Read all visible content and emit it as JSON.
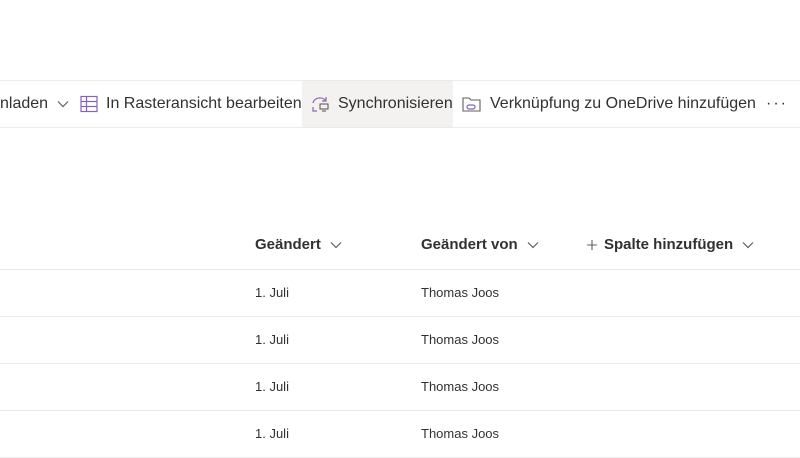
{
  "toolbar": {
    "download_label": "nladen",
    "grid_edit_label": "In Rasteransicht bearbeiten",
    "sync_label": "Synchronisieren",
    "onedrive_shortcut_label": "Verknüpfung zu OneDrive hinzufügen",
    "more_label": "···"
  },
  "columns": {
    "modified": "Geändert",
    "modified_by": "Geändert von",
    "add_column": "Spalte hinzufügen"
  },
  "rows": [
    {
      "modified": "1. Juli",
      "modified_by": "Thomas Joos"
    },
    {
      "modified": "1. Juli",
      "modified_by": "Thomas Joos"
    },
    {
      "modified": "1. Juli",
      "modified_by": "Thomas Joos"
    },
    {
      "modified": "1. Juli",
      "modified_by": "Thomas Joos"
    }
  ],
  "colors": {
    "accent": "#8764b8",
    "hover": "#f3f2f1",
    "divider": "#edebe9"
  }
}
